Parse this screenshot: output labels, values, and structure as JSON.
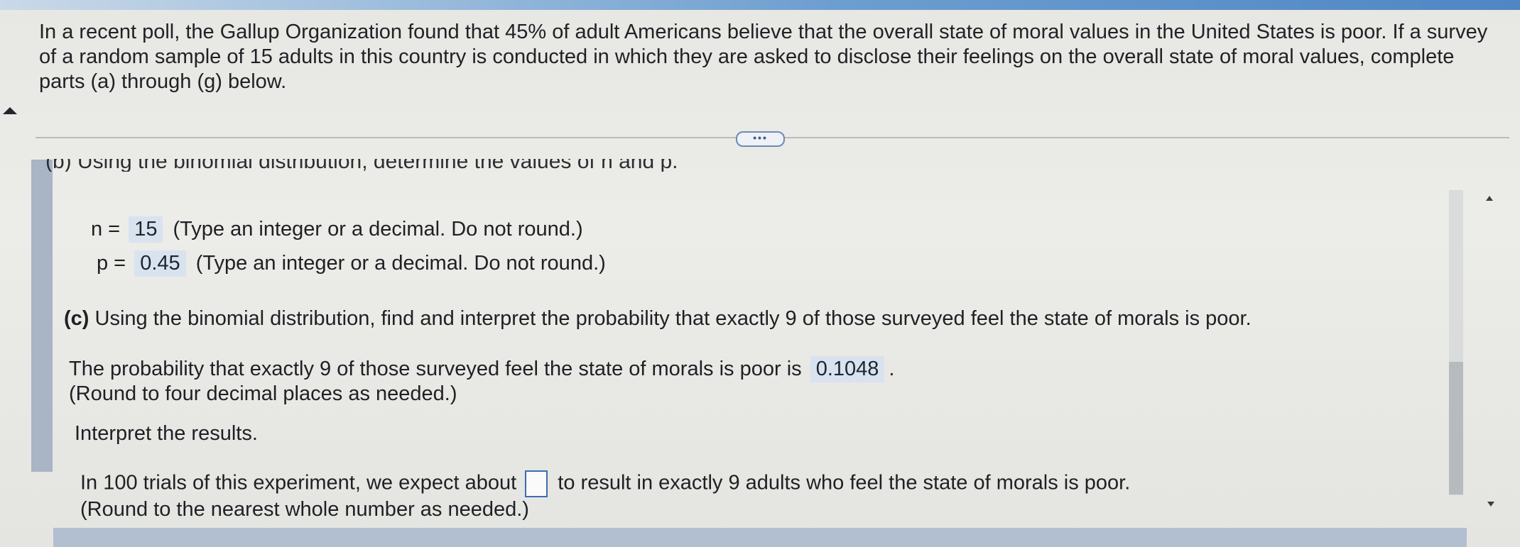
{
  "question": {
    "text": "In a recent poll, the Gallup Organization found that 45% of adult Americans believe that the overall state of moral values in the United States is poor. If a survey of a random sample of 15 adults in this country is conducted in which they are asked to disclose their feelings on the overall state of moral values, complete parts (a) through (g) below."
  },
  "expander": {
    "label": "•••"
  },
  "part_b": {
    "title": "(b) Using the binomial distribution, determine the values of n and p.",
    "n_label": "n =",
    "n_value": "15",
    "n_hint": "(Type an integer or a decimal. Do not round.)",
    "p_label": "p =",
    "p_value": "0.45",
    "p_hint": "(Type an integer or a decimal. Do not round.)"
  },
  "part_c": {
    "label": "(c)",
    "prompt": "Using the binomial distribution, find and interpret the probability that exactly 9 of those surveyed feel the state of morals is poor.",
    "prob_text": "The probability that exactly 9 of those surveyed feel the state of morals is poor is",
    "prob_value": "0.1048",
    "prob_end": ".",
    "prob_hint": "(Round to four decimal places as needed.)",
    "interpret_label": "Interpret the results.",
    "trials_before": "In 100 trials of this experiment, we expect about",
    "trials_after": "to result in exactly 9 adults who feel the state of morals is poor.",
    "trials_hint": "(Round to the nearest whole number as needed.)"
  }
}
